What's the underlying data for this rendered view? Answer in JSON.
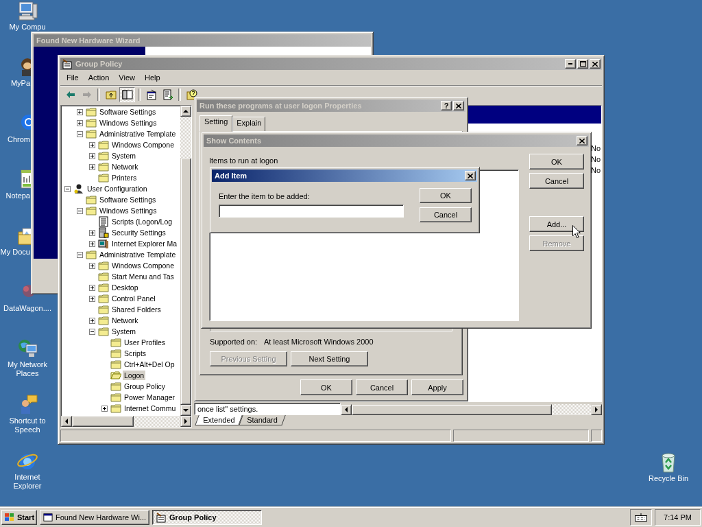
{
  "desktop": {
    "icons": [
      {
        "label": "My Compu",
        "kind": "computer"
      },
      {
        "label": "MyPa",
        "kind": "app"
      },
      {
        "label": "Chrom",
        "kind": "chrome"
      },
      {
        "label": "Notepa",
        "kind": "notepad"
      },
      {
        "label": "My Docu",
        "kind": "documents"
      },
      {
        "label": "DataWagon....",
        "kind": "datawagon"
      },
      {
        "label": "My Network Places",
        "kind": "network"
      },
      {
        "label": "Shortcut to Speech",
        "kind": "speech"
      },
      {
        "label": "Internet Explorer",
        "kind": "browser"
      }
    ],
    "right_icons": [
      {
        "label": "Recycle Bin",
        "kind": "recycle"
      }
    ]
  },
  "hardware_wizard": {
    "title": "Found New Hardware Wizard",
    "active": false
  },
  "group_policy": {
    "title": "Group Policy",
    "active": false,
    "menu": [
      "File",
      "Action",
      "View",
      "Help"
    ],
    "toolbar": [
      {
        "kind": "back",
        "disabled": false,
        "pressed": false
      },
      {
        "kind": "forward",
        "disabled": true,
        "pressed": false
      },
      {
        "kind": "up",
        "disabled": false,
        "pressed": false
      },
      {
        "kind": "tree",
        "disabled": false,
        "pressed": true
      },
      {
        "kind": "properties",
        "disabled": false,
        "pressed": false
      },
      {
        "kind": "export",
        "disabled": false,
        "pressed": false
      },
      {
        "kind": "help",
        "disabled": false,
        "pressed": false
      }
    ],
    "tree": {
      "scrolled_branch": [
        {
          "label": "Software Settings",
          "kind": "folder",
          "expanded": false,
          "selected": false
        },
        {
          "label": "Windows Settings",
          "kind": "folder",
          "expanded": false,
          "selected": false
        },
        {
          "label": "Administrative Template",
          "kind": "folder",
          "expanded": true,
          "selected": false,
          "children": [
            {
              "label": "Windows Compone",
              "kind": "folder",
              "expanded": false,
              "selected": false
            },
            {
              "label": "System",
              "kind": "folder",
              "expanded": false,
              "selected": false
            },
            {
              "label": "Network",
              "kind": "folder",
              "expanded": false,
              "selected": false
            },
            {
              "label": "Printers",
              "kind": "folder",
              "selected": false
            }
          ]
        }
      ],
      "items": [
        {
          "label": "User Configuration",
          "kind": "user",
          "expanded": true,
          "selected": false,
          "children": [
            {
              "label": "Software Settings",
              "kind": "folder",
              "selected": false
            },
            {
              "label": "Windows Settings",
              "kind": "folder",
              "expanded": true,
              "selected": false,
              "children": [
                {
                  "label": "Scripts (Logon/Log",
                  "kind": "scripts",
                  "selected": false
                },
                {
                  "label": "Security Settings",
                  "kind": "security",
                  "expanded": false,
                  "selected": false
                },
                {
                  "label": "Internet Explorer Ma",
                  "kind": "ie",
                  "expanded": false,
                  "selected": false
                }
              ]
            },
            {
              "label": "Administrative Template",
              "kind": "folder",
              "expanded": true,
              "selected": false,
              "children": [
                {
                  "label": "Windows Compone",
                  "kind": "folder",
                  "expanded": false,
                  "selected": false
                },
                {
                  "label": "Start Menu and Tas",
                  "kind": "folder",
                  "selected": false
                },
                {
                  "label": "Desktop",
                  "kind": "folder",
                  "expanded": false,
                  "selected": false
                },
                {
                  "label": "Control Panel",
                  "kind": "folder",
                  "expanded": false,
                  "selected": false
                },
                {
                  "label": "Shared Folders",
                  "kind": "folder",
                  "selected": false
                },
                {
                  "label": "Network",
                  "kind": "folder",
                  "expanded": false,
                  "selected": false
                },
                {
                  "label": "System",
                  "kind": "folder",
                  "expanded": true,
                  "selected": false,
                  "children": [
                    {
                      "label": "User Profiles",
                      "kind": "folder",
                      "selected": false
                    },
                    {
                      "label": "Scripts",
                      "kind": "folder",
                      "selected": false
                    },
                    {
                      "label": "Ctrl+Alt+Del Op",
                      "kind": "folder",
                      "selected": false
                    },
                    {
                      "label": "Logon",
                      "kind": "folder",
                      "selected": true
                    },
                    {
                      "label": "Group Policy",
                      "kind": "folder",
                      "selected": false
                    },
                    {
                      "label": "Power Manager",
                      "kind": "folder",
                      "selected": false
                    },
                    {
                      "label": "Internet Commu",
                      "kind": "folder",
                      "expanded": false,
                      "selected": false
                    }
                  ]
                }
              ]
            }
          ]
        }
      ]
    },
    "results": {
      "cells": [
        "No",
        "No",
        "No"
      ],
      "description": "once list\" settings."
    },
    "view_tabs": [
      {
        "label": "Extended",
        "selected": true
      },
      {
        "label": "Standard",
        "selected": false
      }
    ]
  },
  "properties_dialog": {
    "title": "Run these programs at user logon Properties",
    "active": false,
    "help_button": "?",
    "tabs": [
      {
        "label": "Setting",
        "selected": true
      },
      {
        "label": "Explain",
        "selected": false
      }
    ],
    "supported_label": "Supported on:",
    "supported_value": "At least Microsoft Windows 2000",
    "nav_buttons": [
      {
        "label": "Previous Setting",
        "disabled": true
      },
      {
        "label": "Next Setting",
        "disabled": false
      }
    ],
    "buttons": [
      "OK",
      "Cancel",
      "Apply"
    ]
  },
  "show_contents": {
    "title": "Show Contents",
    "active": false,
    "list_label": "Items to run at logon",
    "buttons": [
      {
        "label": "OK",
        "disabled": false
      },
      {
        "label": "Cancel",
        "disabled": false
      },
      {
        "label": "Add...",
        "disabled": false
      },
      {
        "label": "Remove",
        "disabled": true
      }
    ]
  },
  "add_item": {
    "title": "Add Item",
    "active": true,
    "prompt": "Enter the item to be added:",
    "buttons": [
      "OK",
      "Cancel"
    ]
  },
  "taskbar": {
    "start": "Start",
    "tasks": [
      {
        "label": "Found New Hardware Wi...",
        "selected": false
      },
      {
        "label": "Group Policy",
        "selected": true
      }
    ],
    "clock": "7:14 PM"
  }
}
